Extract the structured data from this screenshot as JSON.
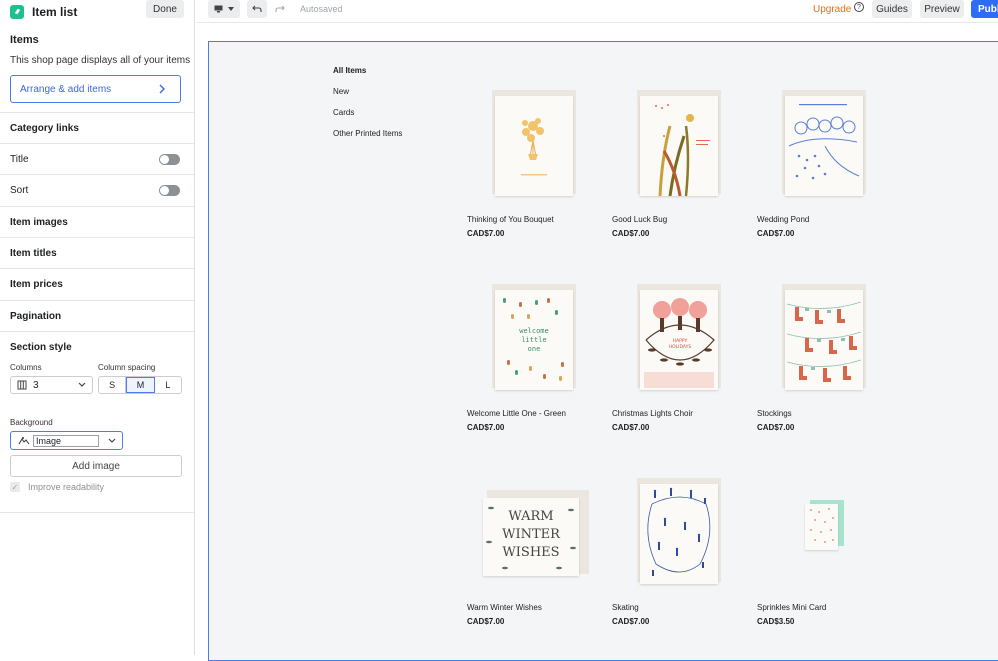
{
  "sidebar": {
    "title": "Item list",
    "done_label": "Done",
    "items_section_title": "Items",
    "items_description": "This shop page displays all of your items",
    "arrange_label": "Arrange & add items",
    "category_links_label": "Category links",
    "title_toggle_label": "Title",
    "sort_toggle_label": "Sort",
    "item_images_label": "Item images",
    "item_titles_label": "Item titles",
    "item_prices_label": "Item prices",
    "pagination_label": "Pagination",
    "section_style_label": "Section style",
    "columns_label": "Columns",
    "columns_value": "3",
    "column_spacing_label": "Column spacing",
    "spacing_options": [
      "S",
      "M",
      "L"
    ],
    "spacing_selected": "M",
    "background_label": "Background",
    "background_value": "Image",
    "add_image_label": "Add image",
    "readability_label": "Improve readability"
  },
  "toolbar": {
    "autosaved": "Autosaved",
    "upgrade": "Upgrade",
    "help": "?",
    "guides": "Guides",
    "preview": "Preview",
    "publish": "Publi"
  },
  "preview": {
    "categories": [
      "All Items",
      "New",
      "Cards",
      "Other Printed Items"
    ],
    "active_category": "All Items",
    "products": [
      {
        "name": "Thinking of You Bouquet",
        "price": "CAD$7.00"
      },
      {
        "name": "Good Luck Bug",
        "price": "CAD$7.00"
      },
      {
        "name": "Wedding Pond",
        "price": "CAD$7.00"
      },
      {
        "name": "Welcome Little One - Green",
        "price": "CAD$7.00"
      },
      {
        "name": "Christmas Lights Choir",
        "price": "CAD$7.00"
      },
      {
        "name": "Stockings",
        "price": "CAD$7.00"
      },
      {
        "name": "Warm Winter Wishes",
        "price": "CAD$7.00"
      },
      {
        "name": "Skating",
        "price": "CAD$7.00"
      },
      {
        "name": "Sprinkles Mini Card",
        "price": "CAD$3.50"
      }
    ],
    "card_text": {
      "welcome": [
        "welcome",
        "little",
        "one"
      ],
      "holidays": [
        "HAPPY",
        "HOLIDAYS"
      ],
      "warm": [
        "WARM",
        "WINTER",
        "WISHES"
      ]
    }
  },
  "colors": {
    "accent": "#2d6df6",
    "upgrade": "#e8710a",
    "logo": "#1fbf8f",
    "selection_outline": "#4a7be6"
  }
}
